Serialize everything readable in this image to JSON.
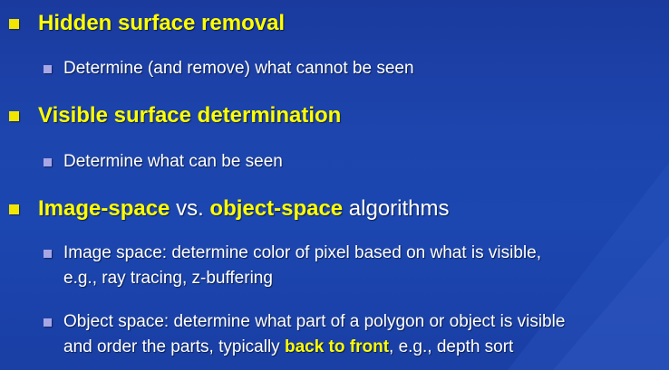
{
  "slide": {
    "items": [
      {
        "heading": "Hidden surface removal",
        "sub": "Determine (and remove) what cannot be seen"
      },
      {
        "heading": "Visible surface determination",
        "sub": "Determine what can be seen"
      },
      {
        "heading_part1": "Image-space",
        "heading_part2": " vs. ",
        "heading_part3": "object-space",
        "heading_part4": " algorithms",
        "sub1_line1": "Image space: determine color of pixel based on what is visible,",
        "sub1_line2": "e.g., ray tracing, z-buffering",
        "sub2_line1": "Object space: determine what part of a polygon or object is visible",
        "sub2_line2_a": "and order the parts, typically ",
        "sub2_line2_b": "back to front",
        "sub2_line2_c": ", e.g., depth sort"
      }
    ]
  },
  "colors": {
    "background": "#1c46b0",
    "highlight": "#ffff00",
    "text": "#ffffff",
    "level1_bullet": "#f2e600",
    "level2_bullet": "#a9a6e6"
  }
}
